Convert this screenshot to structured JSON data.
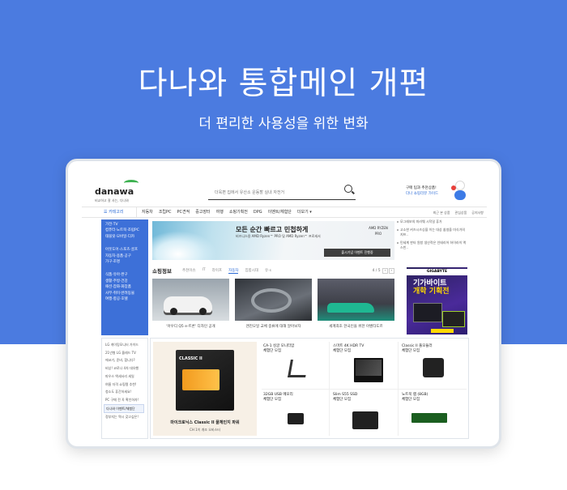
{
  "hero": {
    "title": "다나와 통합메인 개편",
    "subtitle": "더 편리한 사용성을 위한 변화"
  },
  "site": {
    "logo": "danawa",
    "logo_tagline": "비교하고 잘 사는, 다나와",
    "search_placeholder": "더욱편 집에서 유산소 운동할 실내 자전거",
    "promo_line1": "구매 팁과 추천상품!",
    "promo_line2": "다나 쇼핑리뷰 가이드",
    "nav": {
      "category_label": "☰ 카테고리",
      "items": [
        "자동차",
        "조립PC",
        "PC견적",
        "중고장터",
        "여행",
        "쇼핑기획전",
        "DPG",
        "이벤트/체험단",
        "더보기 ▾"
      ],
      "right": [
        "최근 본 상품",
        "관심상품",
        "공지사항"
      ]
    },
    "side_menu": {
      "groups": [
        [
          "가전·TV",
          "컴퓨터·노트북·조립PC",
          "태블릿·모바일·디카"
        ],
        [
          "아웃도어·스포츠·골프",
          "자동차·용품·공구",
          "가구·조명"
        ],
        [
          "식품·유아·완구",
          "생활·주방·건강",
          "패션·잡화·화장품",
          "사무·취미·반려동물",
          "여행·항공·호텔"
        ]
      ]
    },
    "side_links": [
      "LG 게이밍모니터 가이드",
      "21년형 LG 올레드 TV",
      "에코기, 준비, 합니다?",
      "비상! 코로나 4차 대유행",
      "마우스 액세서리 세일",
      "여름 자격 쇼핑템 추천!",
      "청소도 휴간하세요!",
      "PC 구매 전 꼭 확인하자!",
      "다나와 이벤트/체험단",
      "정부지는 역시 갖고싶은!"
    ],
    "banner": {
      "title": "모든 순간 빠르고 민첩하게",
      "subtitle": "비즈니스용 AMD Ryzen™ PRO 및 AMD Ryzen™ 프로세서",
      "chip_label": "AMD RYZEN PRO",
      "tag": "출시기념 이벤트 진행중"
    },
    "shopping": {
      "title": "쇼핑정보",
      "tabs": [
        "추천이슈",
        "IT",
        "라이프",
        "자동차",
        "집합시대",
        "유·s"
      ],
      "active_tab": "자동차",
      "pager": "4 / 5",
      "cards": [
        {
          "caption": "'아우디 Q5 e-트론' 디자인 공개"
        },
        {
          "caption": "엔진오일 교체 중류에 대해 알아보자"
        },
        {
          "caption": "세계최초 한국인을 위한 아벤타도르"
        }
      ]
    },
    "ad": {
      "items": [
        "모그레보의 미러웨 시작일 휴가",
        "고소한 커즈시즈싱을 이는 대상 쉽썽을 미식가의 지프..",
        "민세계 판타 원방 생산적은 인테리어 하이라이 액스빈.."
      ],
      "brand": "GIGABYTE",
      "title_line1": "기가바이트",
      "title_line2": "개학 기획전"
    },
    "deals": {
      "main_title": "마이크로닉스 Classic II 풀체인지 파워",
      "main_sub": "CH 1이 개조 오비스터",
      "psu_label": "CLASSIC II",
      "items": [
        {
          "name": "CA-1 싱글 모니터암",
          "sub": "체험단 모집",
          "kind": "arm"
        },
        {
          "name": "스마트 4K HDR TV",
          "sub": "체험단 모집",
          "kind": "tv"
        },
        {
          "name": "Classic II 풀모듈러",
          "sub": "체험단 모집",
          "kind": "psu"
        },
        {
          "name": "32GB USB 메모리",
          "sub": "체험단 모집",
          "kind": "usb"
        },
        {
          "name": "Slim S55 SSD",
          "sub": "체험단 모집",
          "kind": "ssd"
        },
        {
          "name": "노트북 램 (8GB)",
          "sub": "체험단 모집",
          "kind": "ram"
        }
      ]
    }
  }
}
